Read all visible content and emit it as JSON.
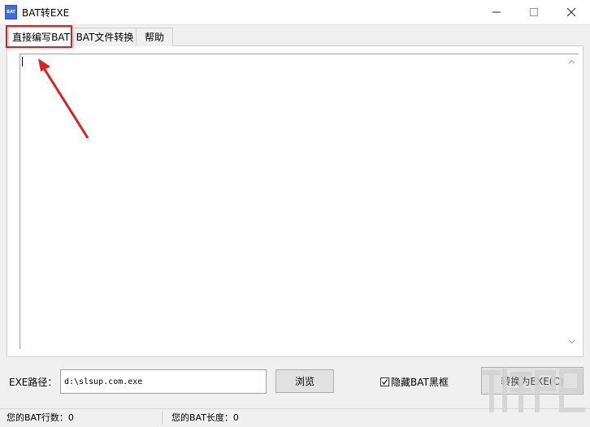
{
  "window": {
    "title": "BAT转EXE",
    "icon": "bat-file-icon"
  },
  "tabs": [
    {
      "label": "直接编写BAT",
      "active": true
    },
    {
      "label": "BAT文件转换",
      "active": false
    },
    {
      "label": "帮助",
      "active": false
    }
  ],
  "editor": {
    "value": ""
  },
  "exe_path": {
    "label": "EXE路径：",
    "value": "d:\\slsup.com.exe"
  },
  "browse_button": "浏览",
  "hide_console": {
    "label": "隐藏BAT黑框",
    "checked": true
  },
  "convert_button": "转换为EXE(C)",
  "status": {
    "line_count": "您的BAT行数：0",
    "length": "您的BAT长度：0"
  },
  "colors": {
    "annotation": "#e02020",
    "watermark": "#cfcfcf"
  }
}
